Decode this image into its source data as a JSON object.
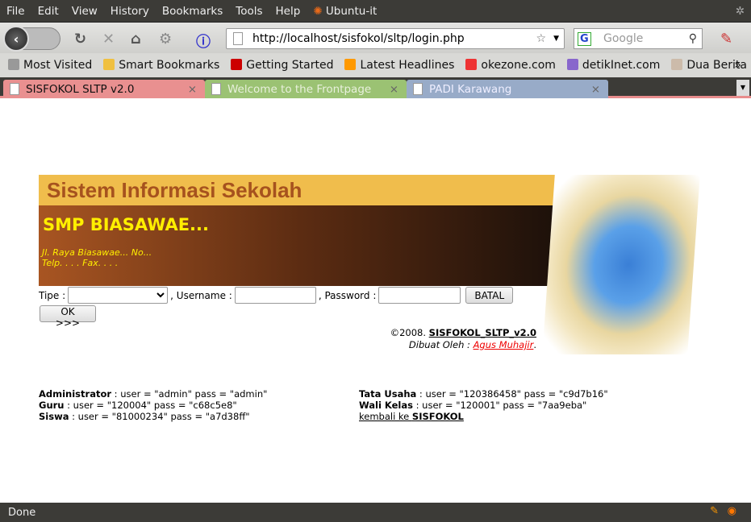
{
  "menu": [
    "File",
    "Edit",
    "View",
    "History",
    "Bookmarks",
    "Tools",
    "Help",
    "Ubuntu-it"
  ],
  "url": "http://localhost/sisfokol/sltp/login.php",
  "search_placeholder": "Google",
  "bookmarks": [
    {
      "label": "Most Visited",
      "color": "#999"
    },
    {
      "label": "Smart Bookmarks",
      "color": "#f0c040"
    },
    {
      "label": "Getting Started",
      "color": "#c00"
    },
    {
      "label": "Latest Headlines",
      "color": "#f90"
    },
    {
      "label": "okezone.com",
      "color": "#e33"
    },
    {
      "label": "detikInet.com",
      "color": "#86c"
    },
    {
      "label": "Dua Berita",
      "color": "#cba"
    }
  ],
  "tabs": [
    {
      "label": "SISFOKOL SLTP v2.0",
      "bg": "#e99090",
      "color": "#111"
    },
    {
      "label": "Welcome to the Frontpage",
      "bg": "#9bc273",
      "color": "#e8f0dc"
    },
    {
      "label": "PADI Karawang",
      "bg": "#98abc8",
      "color": "#eef"
    }
  ],
  "page": {
    "banner_title": "Sistem Informasi Sekolah",
    "school": "SMP BIASAWAE...",
    "address": "Jl. Raya Biasawae... No...",
    "phone": "Telp. . . . Fax. . . .",
    "tipe_label": "Tipe :",
    "username_label": ", Username :",
    "password_label": ", Password :",
    "batal": "BATAL",
    "ok": "OK >>>",
    "copyright": "©2008.",
    "app_name": "SISFOKOL_SLTP_v2.0",
    "made_by": "Dibuat Oleh :",
    "author": "Agus Muhajir",
    "accounts_left": [
      {
        "role": "Administrator",
        "text": " : user = \"admin\" pass = \"admin\""
      },
      {
        "role": "Guru",
        "text": " : user = \"120004\" pass = \"c68c5e8\""
      },
      {
        "role": "Siswa",
        "text": " : user = \"81000234\" pass = \"a7d38ff\""
      }
    ],
    "accounts_right": [
      {
        "role": "Tata Usaha",
        "text": " : user = \"120386458\" pass = \"c9d7b16\""
      },
      {
        "role": "Wali Kelas",
        "text": " : user = \"120001\" pass = \"7aa9eba\""
      }
    ],
    "back_text": "kembali ke ",
    "back_link": "SISFOKOL"
  },
  "status": "Done"
}
